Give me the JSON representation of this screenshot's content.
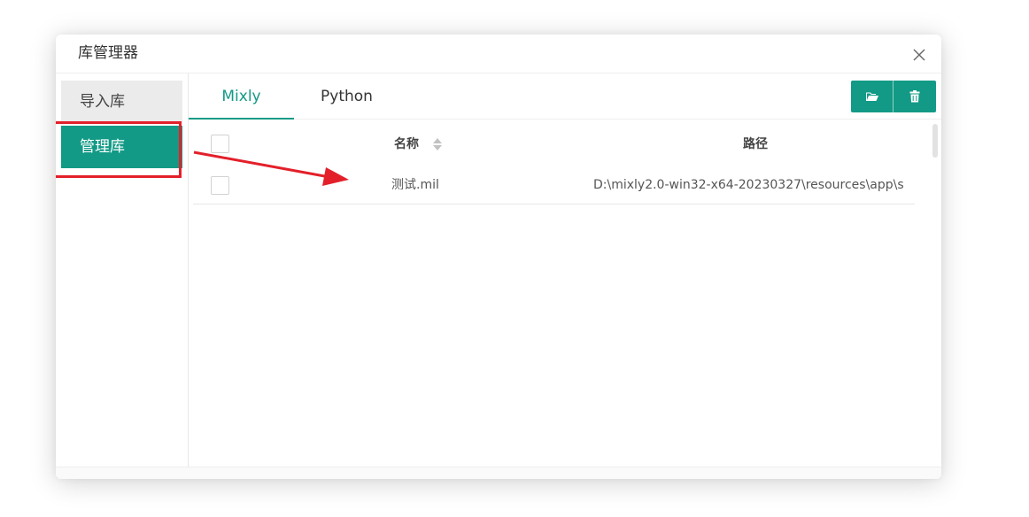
{
  "dialog": {
    "title": "库管理器",
    "close_icon": "close-icon"
  },
  "sidebar": {
    "items": [
      {
        "label": "导入库",
        "active": false
      },
      {
        "label": "管理库",
        "active": true
      }
    ]
  },
  "tabs": [
    {
      "label": "Mixly",
      "active": true
    },
    {
      "label": "Python",
      "active": false
    }
  ],
  "toolbar": {
    "buttons": [
      {
        "icon": "folder-open-icon"
      },
      {
        "icon": "trash-icon"
      }
    ]
  },
  "table": {
    "columns": [
      "名称",
      "路径"
    ],
    "rows": [
      {
        "name": "测试.mil",
        "path": "D:\\mixly2.0-win32-x64-20230327\\resources\\app\\s..."
      }
    ]
  },
  "colors": {
    "accent": "#129a86",
    "highlight": "#e3202a"
  }
}
